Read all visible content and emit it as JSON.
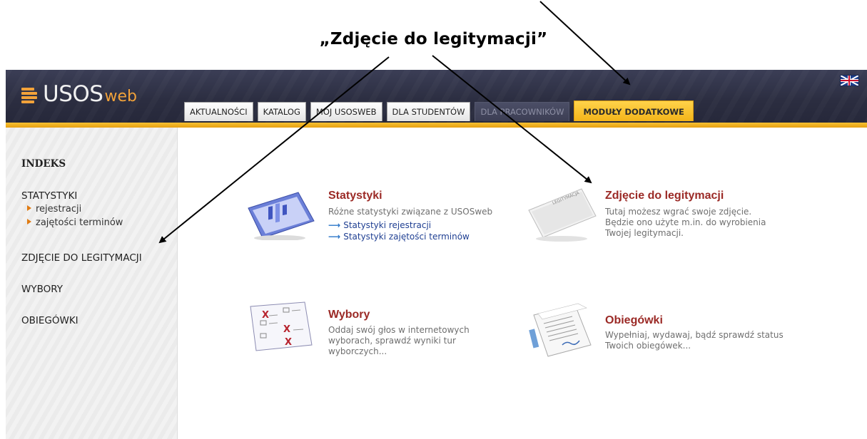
{
  "annotation": {
    "caption": "„Zdjęcie do legitymacji”"
  },
  "header": {
    "logo_text": "USOS",
    "logo_suffix": "web",
    "language_flag_icon": "uk-flag-icon",
    "tabs": [
      {
        "label": "AKTUALNOŚCI",
        "state": "normal"
      },
      {
        "label": "KATALOG",
        "state": "normal"
      },
      {
        "label": "MÓJ USOSWEB",
        "state": "normal"
      },
      {
        "label": "DLA STUDENTÓW",
        "state": "normal"
      },
      {
        "label": "DLA PRACOWNIKÓW",
        "state": "disabled"
      },
      {
        "label": "MODUŁY DODATKOWE",
        "state": "active"
      }
    ]
  },
  "sidebar": {
    "indeks": "INDEKS",
    "statystyki": "STATYSTYKI",
    "statystyki_sub": [
      "rejestracji",
      "zajętości terminów"
    ],
    "zdjecie": "ZDJĘCIE DO LEGITYMACJI",
    "wybory": "WYBORY",
    "obiegowki": "OBIEGÓWKI"
  },
  "cards": {
    "statystyki": {
      "title": "Statystyki",
      "desc": "Różne statystyki związane z USOSweb",
      "links": [
        "Statystyki rejestracji",
        "Statystyki zajętości terminów"
      ]
    },
    "zdjecie": {
      "title": "Zdjęcie do legitymacji",
      "desc": "Tutaj możesz wgrać swoje zdjęcie. Będzie ono użyte m.in. do wyrobienia Twojej legitymacji.",
      "icon_text": "LEGITYMACJA"
    },
    "wybory": {
      "title": "Wybory",
      "desc": "Oddaj swój głos w internetowych wyborach, sprawdź wyniki tur wyborczych..."
    },
    "obiegowki": {
      "title": "Obiegówki",
      "desc": "Wypełniaj, wydawaj, bądź sprawdź status Twoich obiegówek..."
    }
  },
  "colors": {
    "header_bg": "#2b2d40",
    "accent_orange": "#f3b419",
    "title_red": "#9b2a26",
    "link_blue": "#1f3f92"
  }
}
